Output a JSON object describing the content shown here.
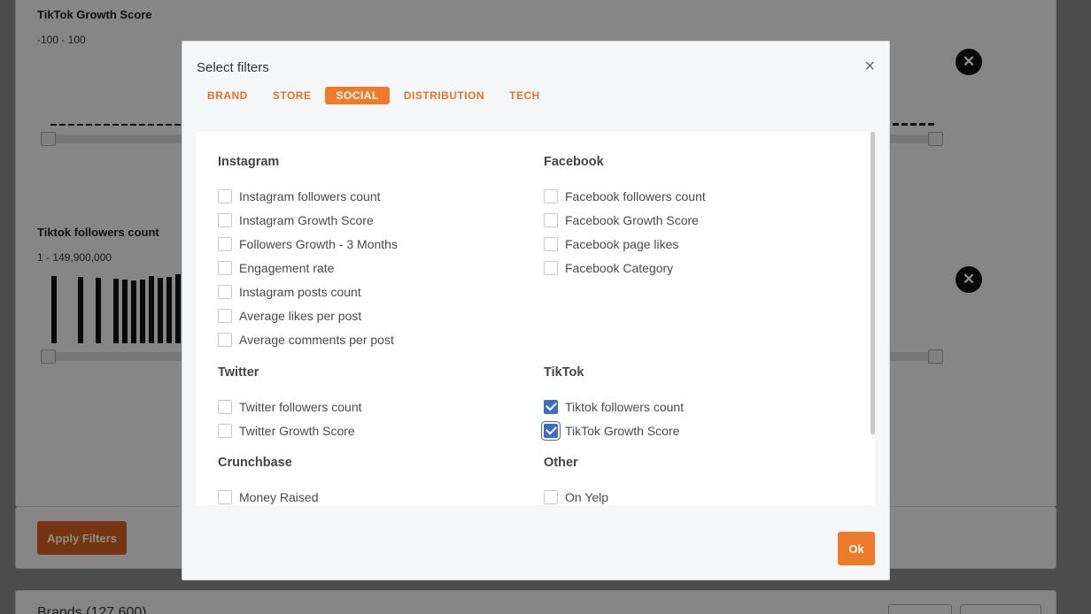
{
  "background": {
    "tiktok_growth": {
      "title": "TikTok Growth Score",
      "range": "-100 - 100"
    },
    "tiktok_followers": {
      "title": "Tiktok followers count",
      "range": "1 - 149,900,000"
    },
    "apply_label": "Apply Filters",
    "brands_title": "Brands (127,600)",
    "remove_icon": "close-icon"
  },
  "modal": {
    "title": "Select filters",
    "close_glyph": "×",
    "tabs": [
      {
        "label": "BRAND",
        "active": false
      },
      {
        "label": "STORE",
        "active": false
      },
      {
        "label": "SOCIAL",
        "active": true
      },
      {
        "label": "DISTRIBUTION",
        "active": false
      },
      {
        "label": "TECH",
        "active": false
      }
    ],
    "groups": {
      "instagram": {
        "title": "Instagram",
        "options": [
          {
            "label": "Instagram followers count",
            "checked": false
          },
          {
            "label": "Instagram Growth Score",
            "checked": false
          },
          {
            "label": "Followers Growth - 3 Months",
            "checked": false
          },
          {
            "label": "Engagement rate",
            "checked": false
          },
          {
            "label": "Instagram posts count",
            "checked": false
          },
          {
            "label": "Average likes per post",
            "checked": false
          },
          {
            "label": "Average comments per post",
            "checked": false
          }
        ]
      },
      "facebook": {
        "title": "Facebook",
        "options": [
          {
            "label": "Facebook followers count",
            "checked": false
          },
          {
            "label": "Facebook Growth Score",
            "checked": false
          },
          {
            "label": "Facebook page likes",
            "checked": false
          },
          {
            "label": "Facebook Category",
            "checked": false
          }
        ]
      },
      "twitter": {
        "title": "Twitter",
        "options": [
          {
            "label": "Twitter followers count",
            "checked": false
          },
          {
            "label": "Twitter Growth Score",
            "checked": false
          }
        ]
      },
      "tiktok": {
        "title": "TikTok",
        "options": [
          {
            "label": "Tiktok followers count",
            "checked": true
          },
          {
            "label": "TikTok Growth Score",
            "checked": true
          }
        ]
      },
      "crunchbase": {
        "title": "Crunchbase",
        "options": [
          {
            "label": "Money Raised",
            "checked": false
          }
        ]
      },
      "other": {
        "title": "Other",
        "options": [
          {
            "label": "On Yelp",
            "checked": false
          }
        ]
      }
    },
    "ok_label": "Ok",
    "colors": {
      "accent": "#ef7a2a",
      "checkbox_checked": "#3f6ec0"
    }
  }
}
